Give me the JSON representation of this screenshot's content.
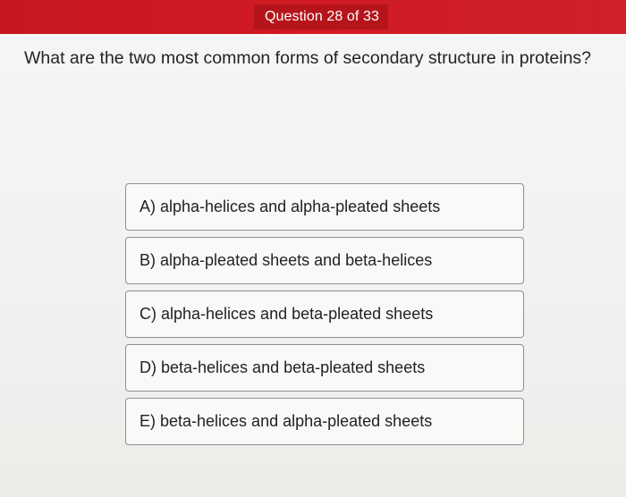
{
  "header": {
    "question_counter": "Question 28 of 33",
    "accent_color": "#d11a23"
  },
  "question": {
    "text": "What are the two most common forms of secondary structure in proteins?"
  },
  "options": [
    {
      "label": "A) alpha-helices and alpha-pleated sheets"
    },
    {
      "label": "B) alpha-pleated sheets and beta-helices"
    },
    {
      "label": "C) alpha-helices and beta-pleated sheets"
    },
    {
      "label": "D) beta-helices and beta-pleated sheets"
    },
    {
      "label": "E) beta-helices and alpha-pleated sheets"
    }
  ]
}
